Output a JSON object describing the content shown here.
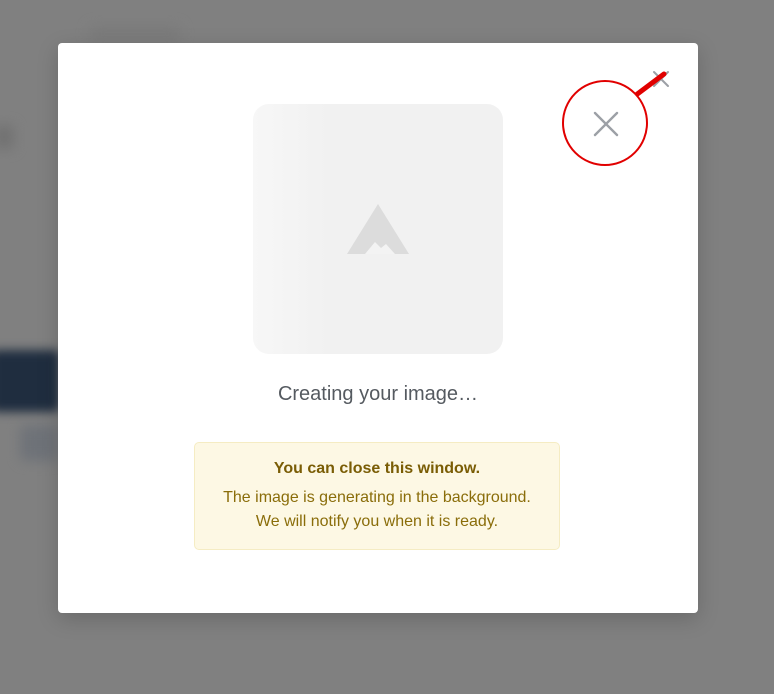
{
  "dialog": {
    "status_text": "Creating your image…",
    "notice": {
      "title": "You can close this window.",
      "line1": "The image is generating in the background.",
      "line2": "We will notify you when it is ready."
    },
    "icons": {
      "close": "close-icon",
      "placeholder": "mountain-image-icon"
    }
  },
  "annotation": {
    "color": "#e10000",
    "icon": "close-icon"
  },
  "colors": {
    "overlay": "#808080",
    "notice_bg": "#fdf8e4",
    "notice_text": "#8a6d0a",
    "status_text": "#555a60",
    "icon_gray": "#9ca0a6"
  }
}
